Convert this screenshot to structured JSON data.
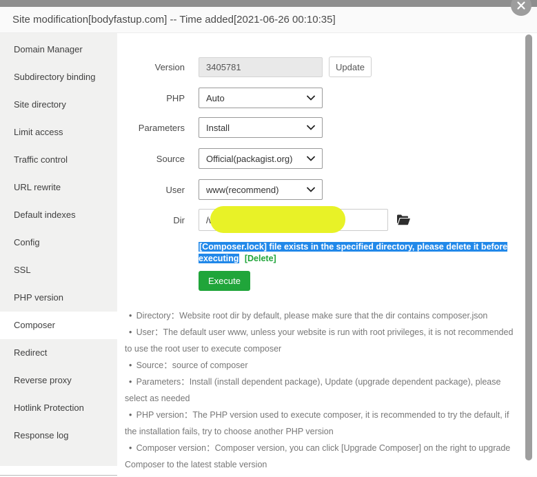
{
  "dialog": {
    "title": "Site modification[bodyfastup.com] -- Time added[2021-06-26 00:10:35]"
  },
  "sidebar": {
    "items": [
      {
        "label": "Domain Manager",
        "active": false
      },
      {
        "label": "Subdirectory binding",
        "active": false
      },
      {
        "label": "Site directory",
        "active": false
      },
      {
        "label": "Limit access",
        "active": false
      },
      {
        "label": "Traffic control",
        "active": false
      },
      {
        "label": "URL rewrite",
        "active": false
      },
      {
        "label": "Default indexes",
        "active": false
      },
      {
        "label": "Config",
        "active": false
      },
      {
        "label": "SSL",
        "active": false
      },
      {
        "label": "PHP version",
        "active": false
      },
      {
        "label": "Composer",
        "active": true
      },
      {
        "label": "Redirect",
        "active": false
      },
      {
        "label": "Reverse proxy",
        "active": false
      },
      {
        "label": "Hotlink Protection",
        "active": false
      },
      {
        "label": "Response log",
        "active": false
      }
    ]
  },
  "form": {
    "version": {
      "label": "Version",
      "value": "3405781",
      "update_label": "Update"
    },
    "php": {
      "label": "PHP",
      "value": "Auto"
    },
    "parameters": {
      "label": "Parameters",
      "value": "Install"
    },
    "source": {
      "label": "Source",
      "value": "Official(packagist.org)"
    },
    "user": {
      "label": "User",
      "value": "www(recommend)"
    },
    "dir": {
      "label": "Dir",
      "value": "/w"
    },
    "warning": {
      "selected_text": "[Composer.lock] file exists in the specified directory, please delete it before executing",
      "delete_label": "[Delete]"
    },
    "execute_label": "Execute"
  },
  "help": {
    "items": [
      "Directory：Website root dir by default, please make sure that the dir contains composer.json",
      "User：The default user www, unless your website is run with root privileges, it is not recommended to use the root user to execute composer",
      "Source：source of composer",
      "Parameters：Install (install dependent package), Update (upgrade dependent package), please select as needed",
      "PHP version：The PHP version used to execute composer, it is recommended to try the default, if the installation fails, try to choose another PHP version",
      "Composer version：Composer version, you can click [Upgrade Composer] on the right to upgrade Composer to the latest stable version"
    ]
  },
  "colors": {
    "accent_green": "#20a53a",
    "selection_blue": "#2188e9",
    "redaction_yellow": "#e8f227",
    "top_strip_gray": "#8e8e8e"
  }
}
